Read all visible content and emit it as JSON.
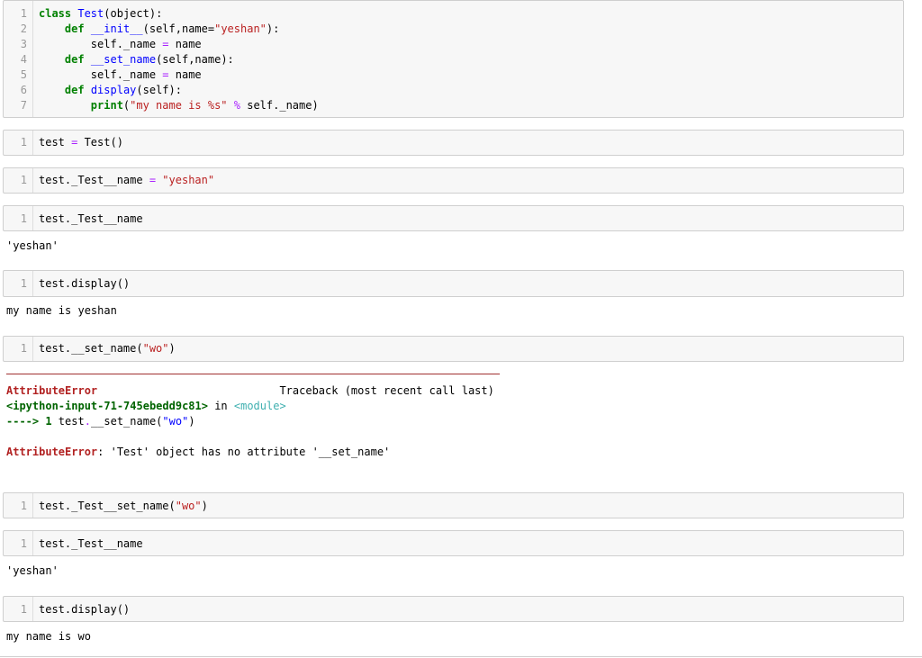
{
  "cells": [
    {
      "line_numbers": [
        "1",
        "2",
        "3",
        "4",
        "5",
        "6",
        "7"
      ],
      "lines": [
        [
          {
            "t": "class",
            "c": "kw"
          },
          {
            "t": " "
          },
          {
            "t": "Test",
            "c": "nm"
          },
          {
            "t": "(object):"
          }
        ],
        [
          {
            "t": "    "
          },
          {
            "t": "def",
            "c": "kw"
          },
          {
            "t": " "
          },
          {
            "t": "__init__",
            "c": "nm"
          },
          {
            "t": "(self,name="
          },
          {
            "t": "\"yeshan\"",
            "c": "st"
          },
          {
            "t": "):"
          }
        ],
        [
          {
            "t": "        self._name "
          },
          {
            "t": "=",
            "c": "op"
          },
          {
            "t": " name"
          }
        ],
        [
          {
            "t": "    "
          },
          {
            "t": "def",
            "c": "kw"
          },
          {
            "t": " "
          },
          {
            "t": "__set_name",
            "c": "nm"
          },
          {
            "t": "(self,name):"
          }
        ],
        [
          {
            "t": "        self._name "
          },
          {
            "t": "=",
            "c": "op"
          },
          {
            "t": " name"
          }
        ],
        [
          {
            "t": "    "
          },
          {
            "t": "def",
            "c": "kw"
          },
          {
            "t": " "
          },
          {
            "t": "display",
            "c": "nm"
          },
          {
            "t": "(self):"
          }
        ],
        [
          {
            "t": "        "
          },
          {
            "t": "print",
            "c": "kw"
          },
          {
            "t": "("
          },
          {
            "t": "\"my name is %s\"",
            "c": "st"
          },
          {
            "t": " "
          },
          {
            "t": "%",
            "c": "op"
          },
          {
            "t": " self._name)"
          }
        ]
      ]
    },
    {
      "line_numbers": [
        "1"
      ],
      "lines": [
        [
          {
            "t": "test "
          },
          {
            "t": "=",
            "c": "op"
          },
          {
            "t": " Test()"
          }
        ]
      ]
    },
    {
      "line_numbers": [
        "1"
      ],
      "lines": [
        [
          {
            "t": "test._Test__name "
          },
          {
            "t": "=",
            "c": "op"
          },
          {
            "t": " "
          },
          {
            "t": "\"yeshan\"",
            "c": "st"
          }
        ]
      ]
    },
    {
      "line_numbers": [
        "1"
      ],
      "lines": [
        [
          {
            "t": "test._Test__name"
          }
        ]
      ],
      "output": "'yeshan'"
    },
    {
      "line_numbers": [
        "1"
      ],
      "lines": [
        [
          {
            "t": "test.display()"
          }
        ]
      ],
      "output": "my name is yeshan"
    },
    {
      "line_numbers": [
        "1"
      ],
      "lines": [
        [
          {
            "t": "test.__set_name("
          },
          {
            "t": "\"wo\"",
            "c": "st"
          },
          {
            "t": ")"
          }
        ]
      ],
      "error": {
        "line1": [
          {
            "t": "AttributeError",
            "c": "ex"
          },
          {
            "t": "                            Traceback (most recent call last)"
          }
        ],
        "line2": [
          {
            "t": "<ipython-input-71-745ebedd9c81>",
            "c": "fr"
          },
          {
            "t": " in "
          },
          {
            "t": "<module>",
            "c": "mod"
          }
        ],
        "line3": [
          {
            "t": "----> 1",
            "c": "fr"
          },
          {
            "t": " test"
          },
          {
            "t": ".",
            "c": "op"
          },
          {
            "t": "__set_name("
          },
          {
            "t": "\"wo\"",
            "c": "nm"
          },
          {
            "t": ")"
          }
        ],
        "line4": [
          {
            "t": "AttributeError",
            "c": "ex"
          },
          {
            "t": ": 'Test' object has no attribute '__set_name'"
          }
        ]
      }
    },
    {
      "line_numbers": [
        "1"
      ],
      "lines": [
        [
          {
            "t": "test._Test__set_name("
          },
          {
            "t": "\"wo\"",
            "c": "st"
          },
          {
            "t": ")"
          }
        ]
      ]
    },
    {
      "line_numbers": [
        "1"
      ],
      "lines": [
        [
          {
            "t": "test._Test__name"
          }
        ]
      ],
      "output": "'yeshan'"
    },
    {
      "line_numbers": [
        "1"
      ],
      "lines": [
        [
          {
            "t": "test.display()"
          }
        ]
      ],
      "output": "my name is wo"
    }
  ]
}
